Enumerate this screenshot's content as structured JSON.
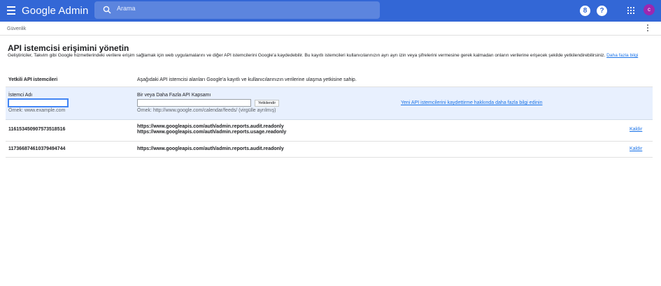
{
  "header": {
    "brand": "Google Admin",
    "search_placeholder": "Arama",
    "support_icon_label": "8",
    "help_icon_label": "?",
    "avatar_initial": "c"
  },
  "breadcrumb": "Güvenlik",
  "page": {
    "title": "API istemcisi erişimini yönetin",
    "description": "Geliştiriciler, Takvim gibi Google hizmetlerindeki verilere erişim sağlamak için web uygulamalarını ve diğer API istemcilerini Google'a kaydedebilir. Bu kayıtlı istemcileri kullanıcılarınızın ayrı ayrı izin veya şifrelerini vermesine gerek kalmadan onların verilerine erişecek şekilde yetkilendirebilirsiniz.",
    "learn_more": "Daha fazla bilgi"
  },
  "table": {
    "header_label": "Yetkili API istemcileri",
    "header_desc": "Aşağıdaki API istemcisi alanları Google'a kayıtlı ve kullanıcılarınızın verilerine ulaşma yetkisine sahip.",
    "form": {
      "client_label": "İstemci Adı",
      "client_value": "",
      "client_example": "Örnek: www.example.com",
      "scope_label": "Bir veya Daha Fazla API Kapsamı",
      "scope_value": "",
      "scope_example": "Örnek: http://www.google.com/calendar/feeds/ (virgülle ayrılmış)",
      "authorize_button": "Yetkilendir",
      "register_link": "Yeni API istemcilerini kaydettirme hakkında daha fazla bilgi edinin"
    },
    "rows": [
      {
        "client_id": "116153450907573518516",
        "scopes": [
          "https://www.googleapis.com/auth/admin.reports.audit.readonly",
          "https://www.googleapis.com/auth/admin.reports.usage.readonly"
        ],
        "remove": "Kaldır"
      },
      {
        "client_id": "117366874610379494744",
        "scopes": [
          "https://www.googleapis.com/auth/admin.reports.audit.readonly"
        ],
        "remove": "Kaldır"
      }
    ]
  },
  "colors": {
    "topbar": "#3367d6",
    "accent": "#1a73e8",
    "form_bg": "#e8f0fe",
    "avatar": "#9c27b0"
  }
}
